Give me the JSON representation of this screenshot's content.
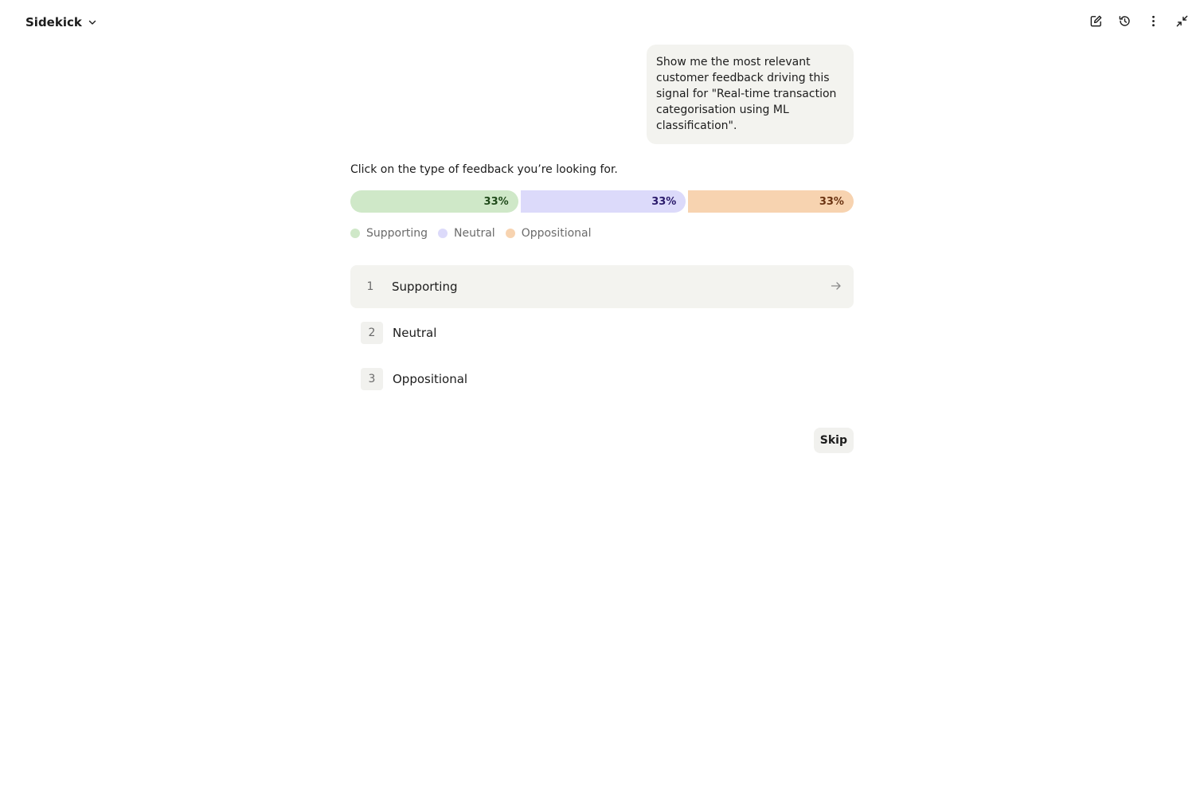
{
  "app": {
    "title": "Sidekick"
  },
  "toolbar": {
    "icons": [
      "new-chat-icon",
      "history-icon",
      "more-vertical-icon",
      "minimize-icon"
    ]
  },
  "conversation": {
    "user_message": "Show me the most relevant customer feedback driving this signal for \"Real-time transaction categorisation using ML classification\".",
    "prompt": "Click on the type of feedback you’re looking for.",
    "distribution": [
      {
        "label": "Supporting",
        "percent_label": "33%",
        "value": 33.3,
        "color": "#cfe8c8",
        "text_color": "#1f4a1a"
      },
      {
        "label": "Neutral",
        "percent_label": "33%",
        "value": 33.3,
        "color": "#dcdafa",
        "text_color": "#2a1a6b"
      },
      {
        "label": "Oppositional",
        "percent_label": "33%",
        "value": 33.3,
        "color": "#f7d3b0",
        "text_color": "#6b3312"
      }
    ],
    "legend": [
      {
        "label": "Supporting",
        "color": "#cfe8c8"
      },
      {
        "label": "Neutral",
        "color": "#dcdafa"
      },
      {
        "label": "Oppositional",
        "color": "#f7d3b0"
      }
    ],
    "options": [
      {
        "number": "1",
        "label": "Supporting"
      },
      {
        "number": "2",
        "label": "Neutral"
      },
      {
        "number": "3",
        "label": "Oppositional"
      }
    ],
    "skip_label": "Skip"
  }
}
